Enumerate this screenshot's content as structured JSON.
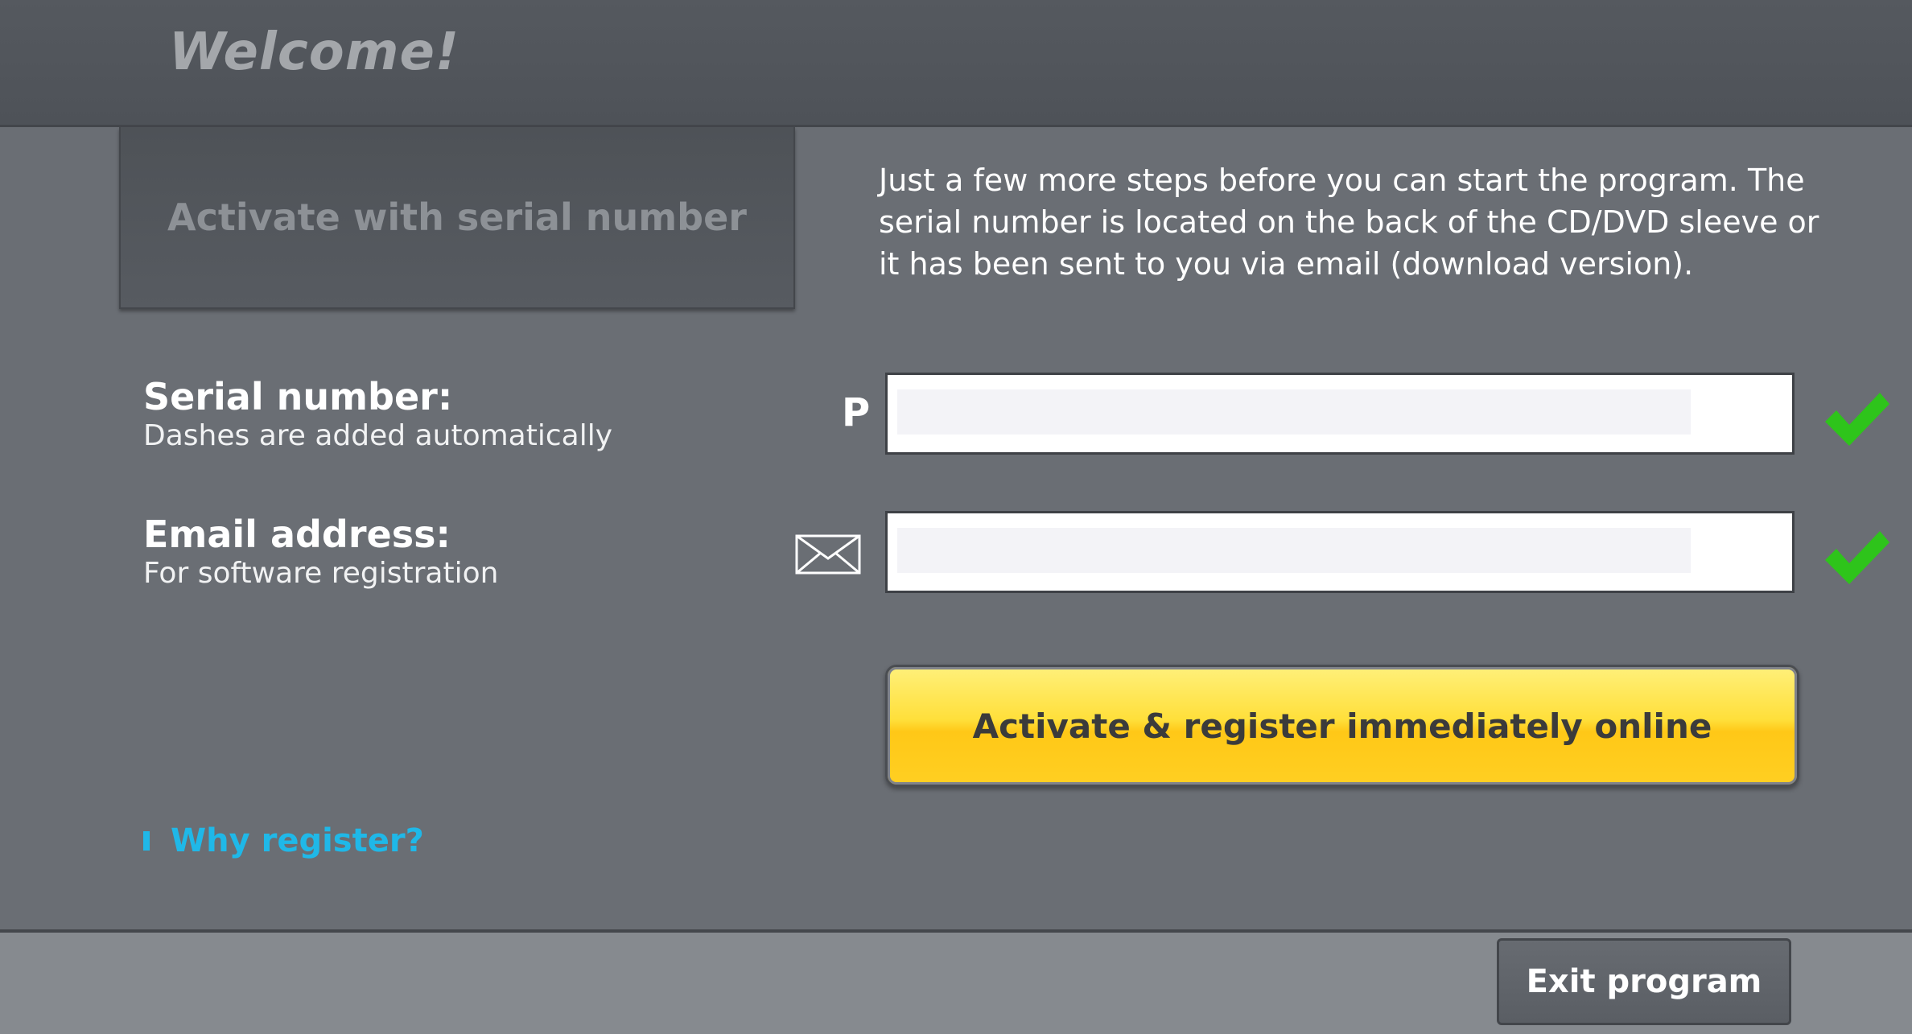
{
  "header": {
    "title": "Welcome!"
  },
  "tab": {
    "label": "Activate with serial number"
  },
  "intro": {
    "text": "Just a few more steps before you can start the program. The serial number is located on the back of the CD/DVD sleeve or it has been sent to you via email (download version)."
  },
  "serial": {
    "label": "Serial number:",
    "hint": "Dashes are added automatically",
    "prefix": "P",
    "value": "",
    "status_icon": "checkmark-icon"
  },
  "email": {
    "label": "Email address:",
    "hint": "For software registration",
    "icon": "envelope-icon",
    "value": "",
    "status_icon": "checkmark-icon"
  },
  "actions": {
    "activate_label": "Activate & register immediately online",
    "why_register_label": "Why register?",
    "exit_label": "Exit program"
  },
  "colors": {
    "accent_yellow": "#ffd22a",
    "link_blue": "#1fb8e8",
    "check_green": "#2ec41b",
    "background": "#6a6e74"
  }
}
